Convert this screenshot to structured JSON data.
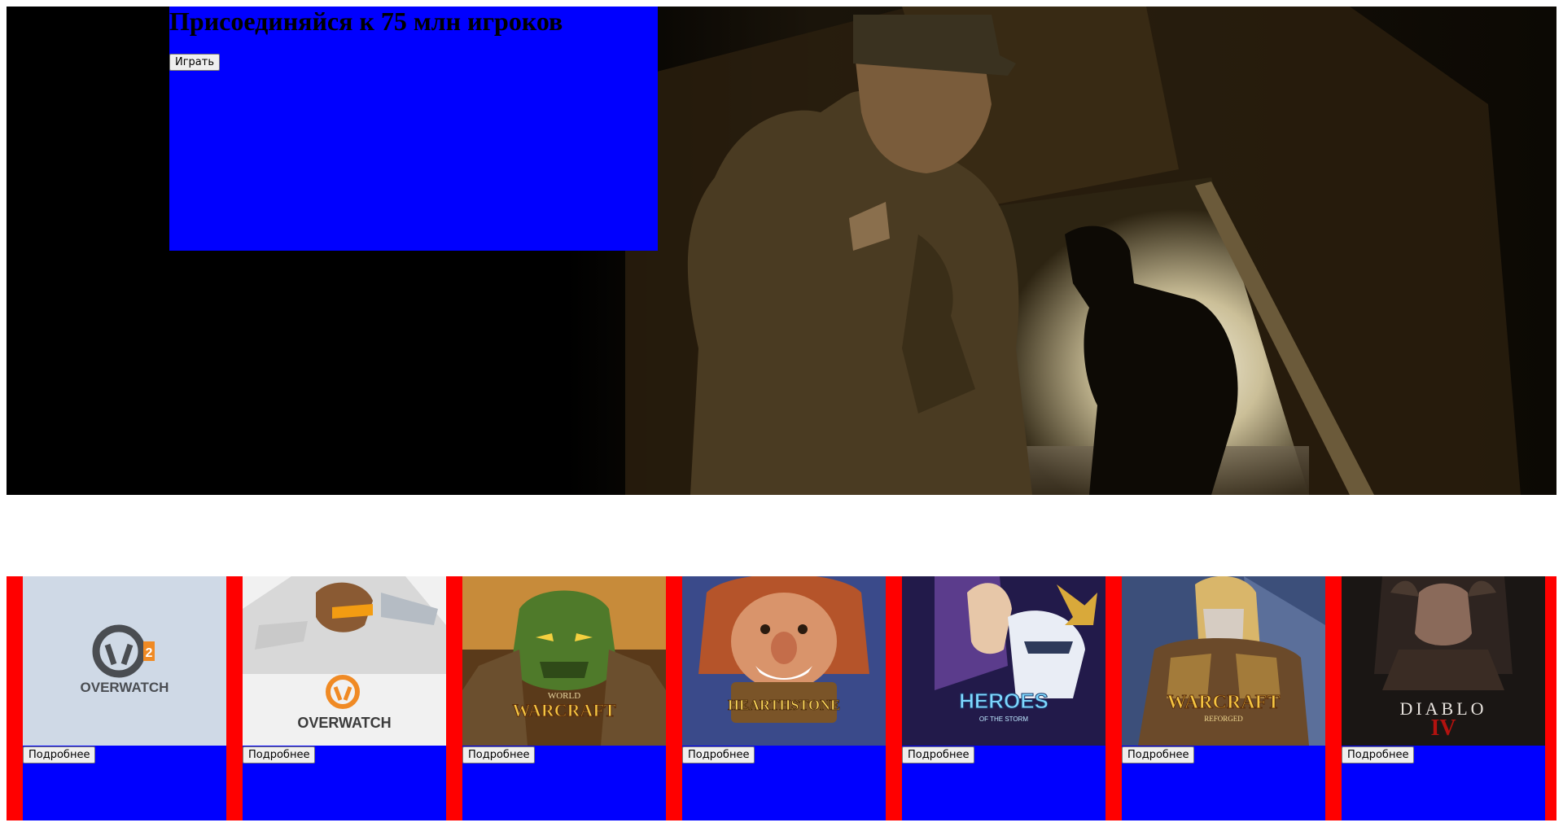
{
  "hero": {
    "title": "Присоединяйся к 75 млн игроков",
    "play_label": "Играть"
  },
  "games": [
    {
      "logo": "OVERWATCH",
      "badge": "2",
      "more_label": "Подробнее"
    },
    {
      "logo": "OVERWATCH",
      "more_label": "Подробнее"
    },
    {
      "logo_top": "WORLD",
      "logo": "WARCRAFT",
      "more_label": "Подробнее"
    },
    {
      "logo": "HEARTHSTONE",
      "more_label": "Подробнее"
    },
    {
      "logo": "HEROES",
      "logo_sub": "OF THE STORM",
      "more_label": "Подробнее"
    },
    {
      "logo": "WARCRAFT",
      "logo_sub": "REFORGED",
      "more_label": "Подробнее"
    },
    {
      "logo": "DIABLO",
      "badge": "IV",
      "more_label": "Подробнее"
    }
  ],
  "colors": {
    "hero_card": "#0000ff",
    "games_strip": "#ff0000",
    "game_card": "#0000ff"
  }
}
